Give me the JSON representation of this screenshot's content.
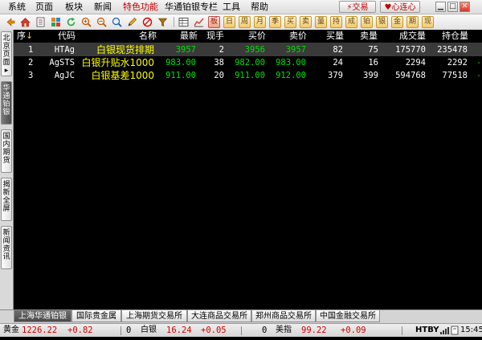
{
  "menu": {
    "items": [
      {
        "label": "系统",
        "active": false
      },
      {
        "label": "页面",
        "active": false
      },
      {
        "label": "板块",
        "active": false
      },
      {
        "label": "新闻",
        "active": false
      },
      {
        "label": "特色功能",
        "active": true
      },
      {
        "label": "华通铂银专栏",
        "active": false
      },
      {
        "label": "工具",
        "active": false
      },
      {
        "label": "帮助",
        "active": false
      }
    ],
    "trade_button": "交易",
    "heart_button": "心连心",
    "window_controls": {
      "minimize": "▁",
      "maximize": "□",
      "close": "✕"
    }
  },
  "toolbar": {
    "icons": [
      "home-icon",
      "document-icon",
      "grid-icon",
      "refresh-icon",
      "zoom-in-icon",
      "zoom-out-icon",
      "magnify-icon",
      "pencil-icon",
      "cancel-icon",
      "filter-icon",
      "table-icon",
      "chart-icon"
    ],
    "char_buttons": [
      {
        "text": "板",
        "style": "red"
      },
      {
        "text": "日",
        "style": "normal"
      },
      {
        "text": "周",
        "style": "normal"
      },
      {
        "text": "月",
        "style": "normal"
      },
      {
        "text": "季",
        "style": "normal"
      },
      {
        "text": "买",
        "style": "normal"
      },
      {
        "text": "卖",
        "style": "normal"
      },
      {
        "text": "量",
        "style": "normal"
      },
      {
        "text": "持",
        "style": "normal"
      },
      {
        "text": "成",
        "style": "normal"
      },
      {
        "text": "铂",
        "style": "normal"
      },
      {
        "text": "银",
        "style": "normal"
      },
      {
        "text": "金",
        "style": "normal"
      },
      {
        "text": "期",
        "style": "normal"
      },
      {
        "text": "现",
        "style": "normal"
      }
    ]
  },
  "side_tabs": [
    {
      "label": "北\n京\n页\n面\n▸",
      "active": false
    },
    {
      "label": "华\n通\n铂\n银",
      "active": true
    },
    {
      "label": "国\n内\n期\n货",
      "active": false
    },
    {
      "label": "揭\n新\n全\n屏",
      "active": false
    },
    {
      "label": "新\n闻\n资\n讯",
      "active": false
    }
  ],
  "table": {
    "columns": {
      "seq": "序",
      "sort_marker": "↓",
      "code": "代码",
      "name": "名称",
      "latest": "最新",
      "volume_now": "现手",
      "bid": "买价",
      "ask": "卖价",
      "bid_volume": "买量",
      "ask_volume": "卖量",
      "turnover": "成交量",
      "open_interest": "持仓量"
    },
    "rows": [
      {
        "seq": "1",
        "code": "HTAg",
        "name": "白银现货排期",
        "latest": "3957",
        "volume_now": "2",
        "bid": "3956",
        "ask": "3957",
        "bid_volume": "82",
        "ask_volume": "75",
        "turnover": "175770",
        "open_interest": "235478",
        "edge": "",
        "selected": true
      },
      {
        "seq": "2",
        "code": "AgSTS",
        "name": "白银升贴水1000",
        "latest": "983.00",
        "volume_now": "38",
        "bid": "982.00",
        "ask": "983.00",
        "bid_volume": "24",
        "ask_volume": "16",
        "turnover": "2294",
        "open_interest": "2292",
        "edge": "-",
        "selected": false
      },
      {
        "seq": "3",
        "code": "AgJC",
        "name": "白银基差1000",
        "latest": "911.00",
        "volume_now": "20",
        "bid": "911.00",
        "ask": "912.00",
        "bid_volume": "379",
        "ask_volume": "399",
        "turnover": "594768",
        "open_interest": "77518",
        "edge": "-",
        "selected": false
      }
    ]
  },
  "bottom_tabs": [
    {
      "label": "上海华通铂银",
      "active": true
    },
    {
      "label": "国际贵金属",
      "active": false
    },
    {
      "label": "上海期货交易所",
      "active": false
    },
    {
      "label": "大连商品交易所",
      "active": false
    },
    {
      "label": "郑州商品交易所",
      "active": false
    },
    {
      "label": "中国金融交易所",
      "active": false
    }
  ],
  "status": {
    "gold_label": "黄金",
    "gold_price": "1226.22",
    "gold_change": "+0.82",
    "silver_label": "白银",
    "silver_price": "16.24",
    "silver_change": "+0.05",
    "usd_label": "美指",
    "usd_price": "99.22",
    "usd_change": "+0.09",
    "provider": "HTBY",
    "time": "15:45"
  },
  "colors": {
    "background": "#000000",
    "header_text": "#ffffff",
    "up": "#00e000",
    "name": "#ffff00",
    "down": "#ff3a3a",
    "active_menu": "#c40000"
  }
}
